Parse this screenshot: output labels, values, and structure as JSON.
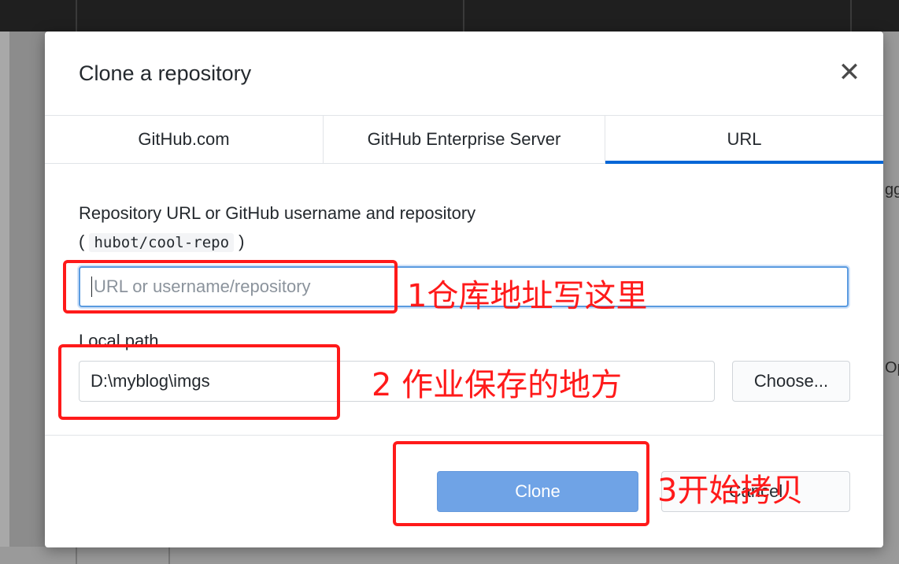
{
  "background": {
    "right_fragment_1": "gg",
    "right_fragment_2": "Op"
  },
  "dialog": {
    "title": "Clone a repository",
    "close_icon": "close-icon",
    "close_glyph": "✕",
    "tabs": [
      {
        "label": "GitHub.com",
        "active": false
      },
      {
        "label": "GitHub Enterprise Server",
        "active": false
      },
      {
        "label": "URL",
        "active": true
      }
    ],
    "url_field": {
      "label": "Repository URL or GitHub username and repository",
      "hint_open": "(",
      "hint_code": "hubot/cool-repo",
      "hint_close": ")",
      "placeholder": "URL or username/repository",
      "value": ""
    },
    "path_field": {
      "label": "Local path",
      "value": "D:\\myblog\\imgs"
    },
    "choose_label": "Choose...",
    "clone_label": "Clone",
    "cancel_label": "Cancel"
  },
  "annotations": {
    "note1": "1仓库地址写这里",
    "note2": "2 作业保存的地方",
    "note3": "3开始拷贝"
  },
  "colors": {
    "accent": "#0366d6",
    "clone_button": "#6fa3e6",
    "annotation": "#ff1a1a"
  }
}
